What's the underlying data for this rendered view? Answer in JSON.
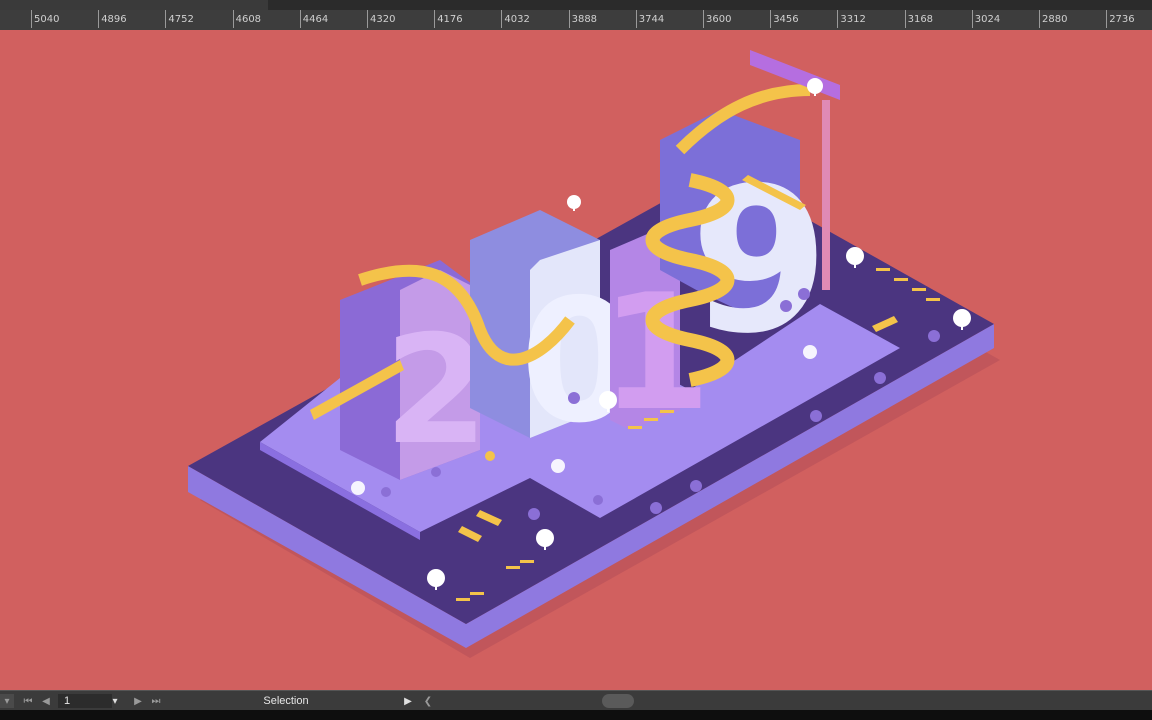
{
  "ruler": {
    "ticks": [
      "5040",
      "4896",
      "4752",
      "4608",
      "4464",
      "4320",
      "4176",
      "4032",
      "3888",
      "3744",
      "3600",
      "3456",
      "3312",
      "3168",
      "3024",
      "2880",
      "2736"
    ]
  },
  "artwork": {
    "year_digits": [
      "2",
      "0",
      "1",
      "9"
    ]
  },
  "statusbar": {
    "page_number": "1",
    "tool_label": "Selection"
  },
  "colors": {
    "canvas_bg": "#d1605f",
    "platform_dark": "#4b3580",
    "platform_mid": "#7a62c9",
    "platform_light": "#a48cf0",
    "accent_yellow": "#f4c34a"
  }
}
